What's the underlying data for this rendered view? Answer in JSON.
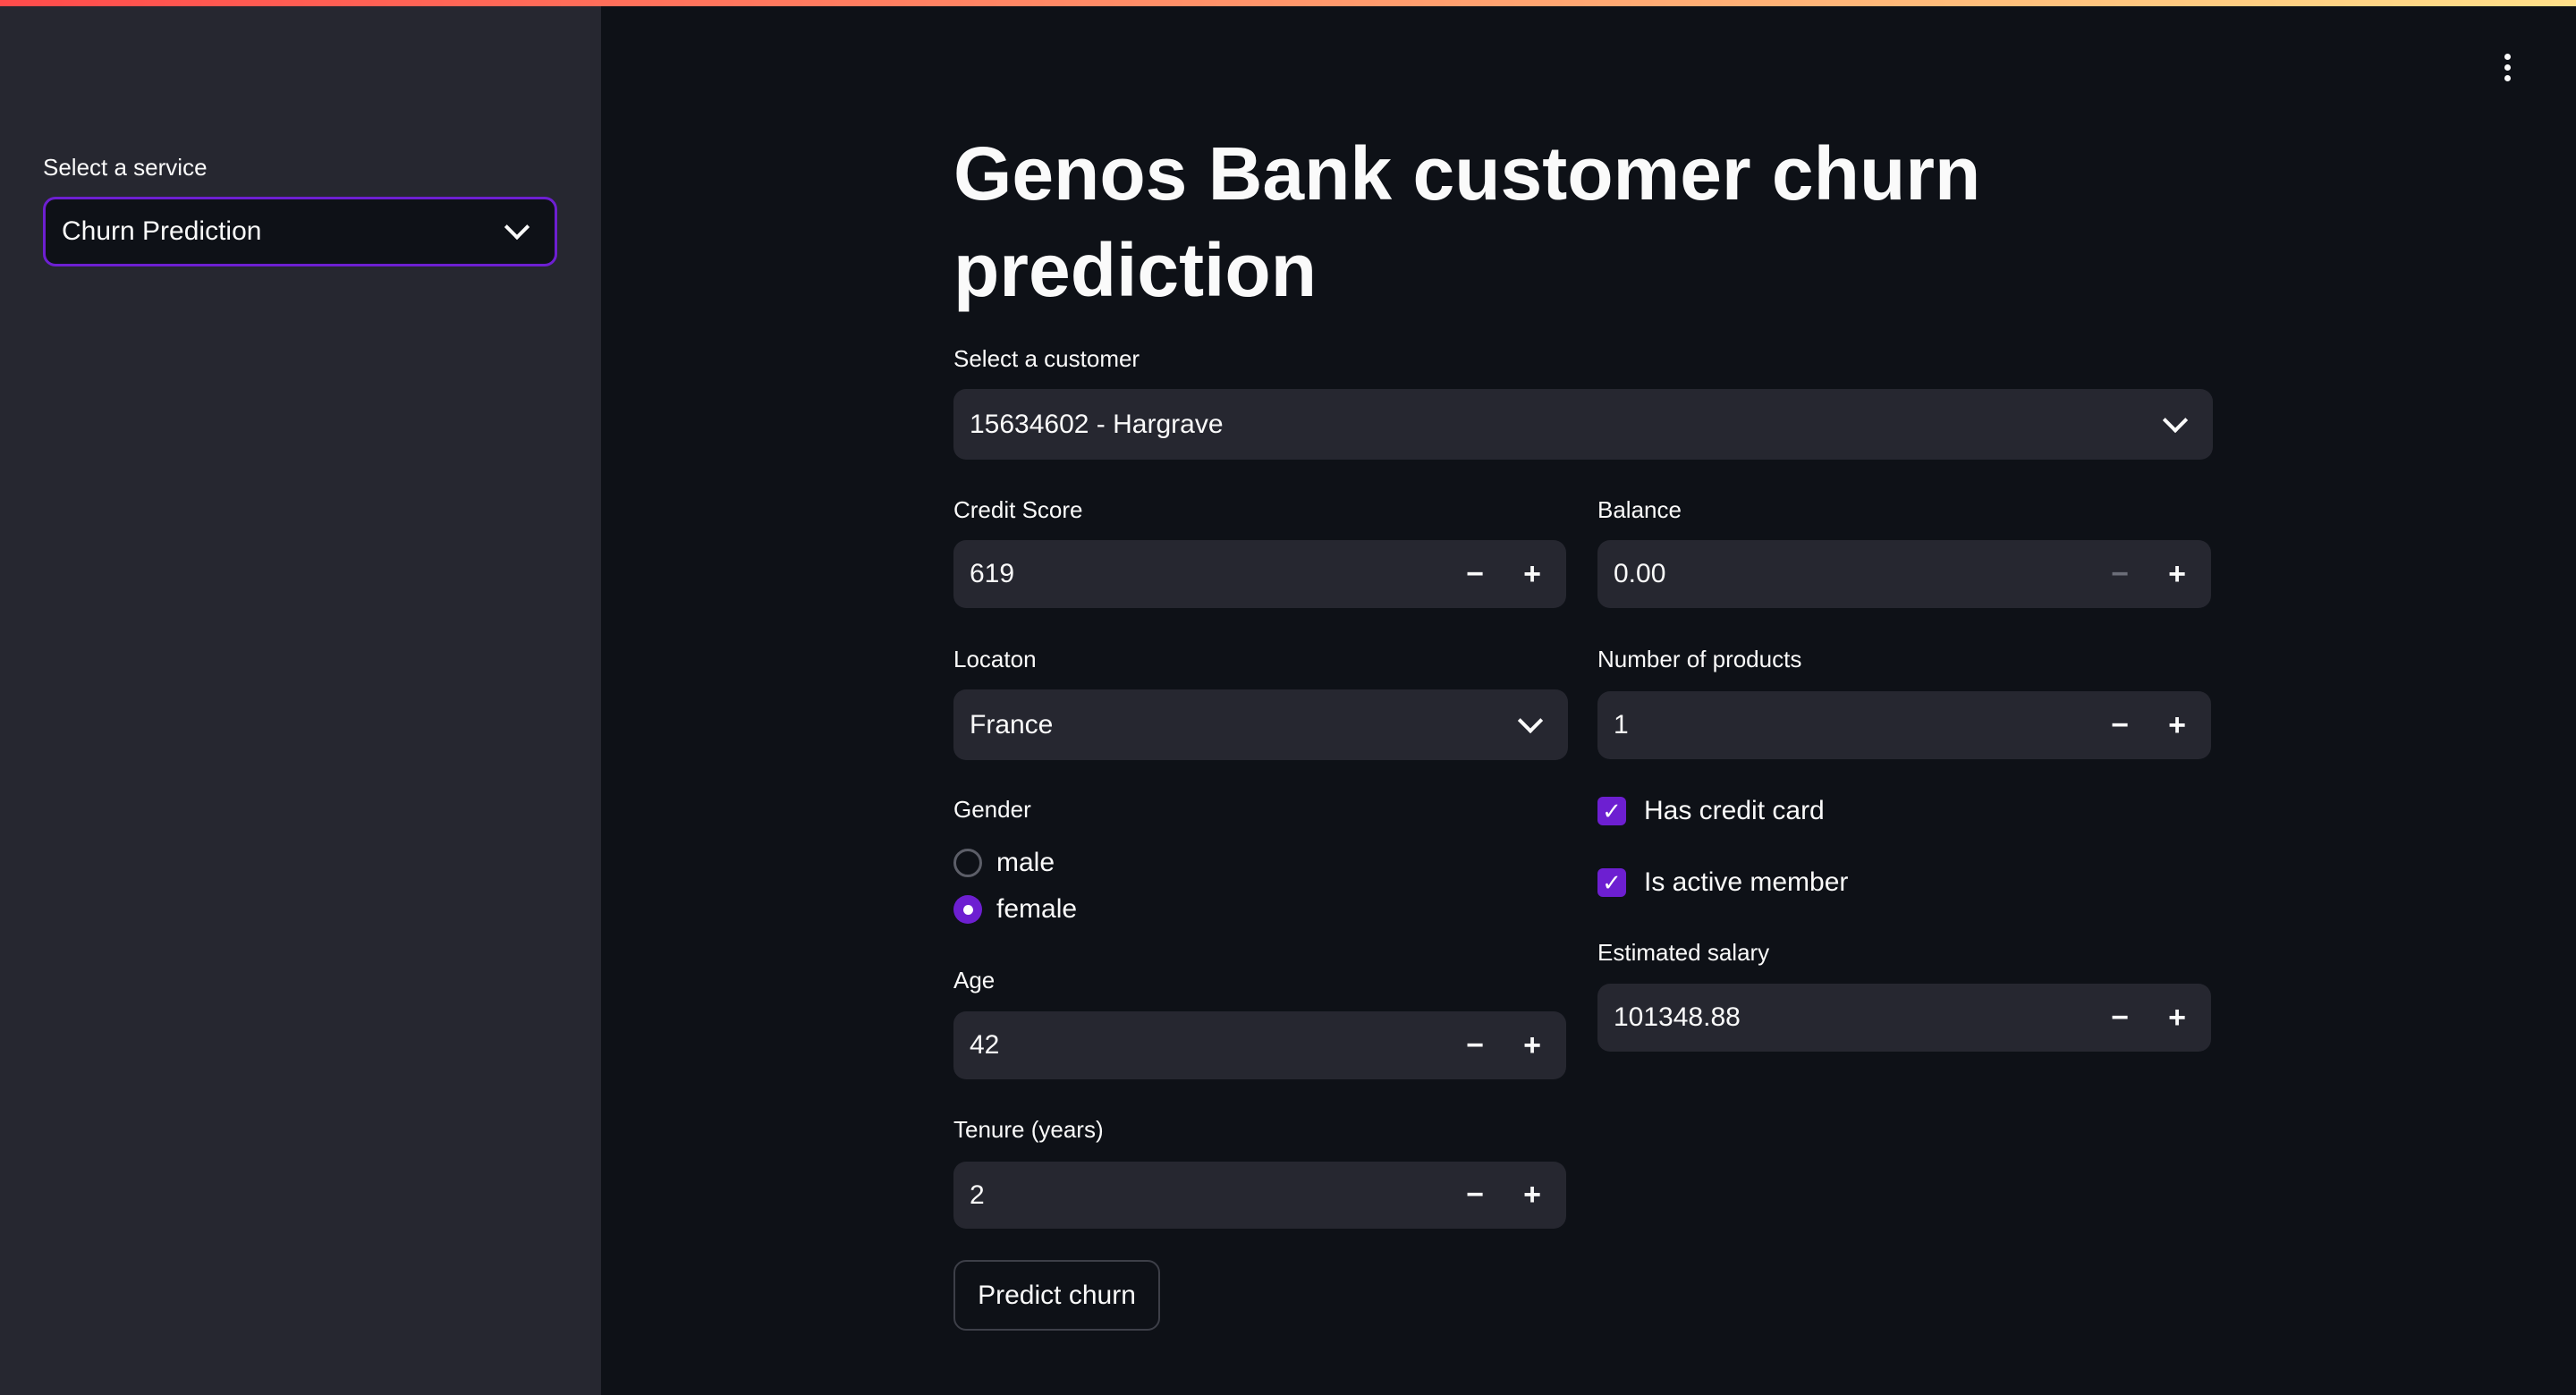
{
  "sidebar": {
    "service_label": "Select a service",
    "service_value": "Churn Prediction"
  },
  "main": {
    "title": "Genos Bank customer churn prediction",
    "customer": {
      "label": "Select a customer",
      "value": "15634602 - Hargrave"
    },
    "credit_score": {
      "label": "Credit Score",
      "value": "619"
    },
    "balance": {
      "label": "Balance",
      "value": "0.00"
    },
    "location": {
      "label": "Locaton",
      "value": "France"
    },
    "num_products": {
      "label": "Number of products",
      "value": "1"
    },
    "gender": {
      "label": "Gender",
      "options": [
        "male",
        "female"
      ],
      "selected": "female"
    },
    "has_credit_card": {
      "label": "Has credit card",
      "checked": true
    },
    "is_active_member": {
      "label": "Is active member",
      "checked": true
    },
    "age": {
      "label": "Age",
      "value": "42"
    },
    "estimated_salary": {
      "label": "Estimated salary",
      "value": "101348.88"
    },
    "tenure": {
      "label": "Tenure (years)",
      "value": "2"
    },
    "predict_button": "Predict churn",
    "minus": "−",
    "plus": "+"
  },
  "colors": {
    "accent": "#6d1fd1",
    "background": "#0e1117",
    "sidebar": "#262730"
  }
}
